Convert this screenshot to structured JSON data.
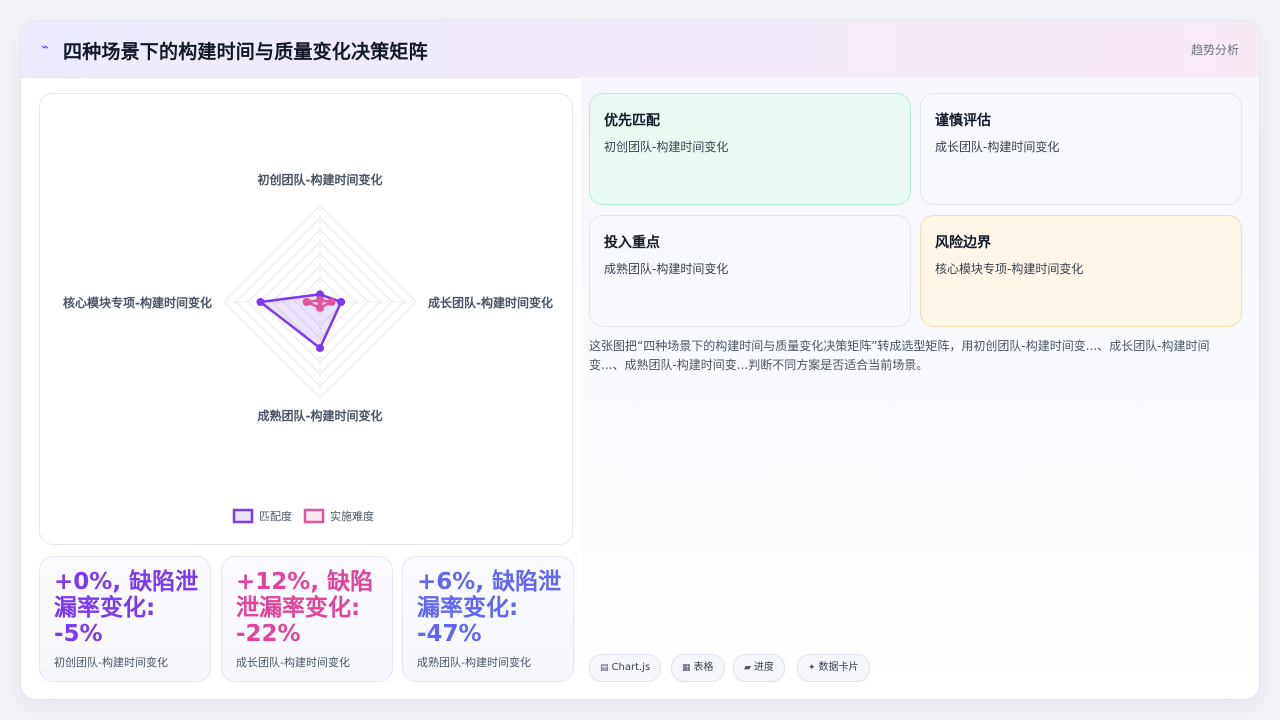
{
  "header": {
    "icon": "trend-line-icon",
    "title": "四种场景下的构建时间与质量变化决策矩阵",
    "mode": "趋势分析"
  },
  "chart_data": {
    "type": "radar",
    "axes": [
      "初创团队-构建时间变化",
      "成长团队-构建时间变化",
      "成熟团队-构建时间变化",
      "核心模块专项-构建时间变化"
    ],
    "range": [
      0,
      100
    ],
    "grid_levels": 8,
    "series": [
      {
        "name": "匹配度",
        "values": [
          8,
          22,
          48,
          62
        ],
        "color": "#7c3aed"
      },
      {
        "name": "实施难度",
        "values": [
          2,
          12,
          6,
          14
        ],
        "color": "#e0559b"
      }
    ],
    "legend_position": "bottom"
  },
  "stats": [
    {
      "value": "+0%, 缺陷泄漏率变化: -5%",
      "label": "初创团队-构建时间变化",
      "color": "#7c3aed"
    },
    {
      "value": "+12%, 缺陷泄漏率变化: -22%",
      "label": "成长团队-构建时间变化",
      "color": "#e0459b"
    },
    {
      "value": "+6%, 缺陷泄漏率变化: -47%",
      "label": "成熟团队-构建时间变化",
      "color": "#6366f1"
    }
  ],
  "quadrants": [
    {
      "title": "优先匹配",
      "subtitle": "初创团队-构建时间变化"
    },
    {
      "title": "谨慎评估",
      "subtitle": "成长团队-构建时间变化"
    },
    {
      "title": "投入重点",
      "subtitle": "成熟团队-构建时间变化"
    },
    {
      "title": "风险边界",
      "subtitle": "核心模块专项-构建时间变化"
    }
  ],
  "description": "这张图把“四种场景下的构建时间与质量变化决策矩阵”转成选型矩阵，用初创团队-构建时间变...、成长团队-构建时间变...、成熟团队-构建时间变...判断不同方案是否适合当前场景。",
  "tags": [
    {
      "icon": "chart-icon",
      "glyph": "▤",
      "label": "Chart.js"
    },
    {
      "icon": "table-icon",
      "glyph": "▦",
      "label": "表格"
    },
    {
      "icon": "progress-icon",
      "glyph": "▰",
      "label": "进度"
    },
    {
      "icon": "sparkle-icon",
      "glyph": "✦",
      "label": "数据卡片"
    }
  ],
  "colors": {
    "accent": "#7c3aed",
    "pink": "#e0559b",
    "indigo": "#6366f1",
    "green_card": "#eafbf3",
    "orange_card": "#fff6ea"
  }
}
